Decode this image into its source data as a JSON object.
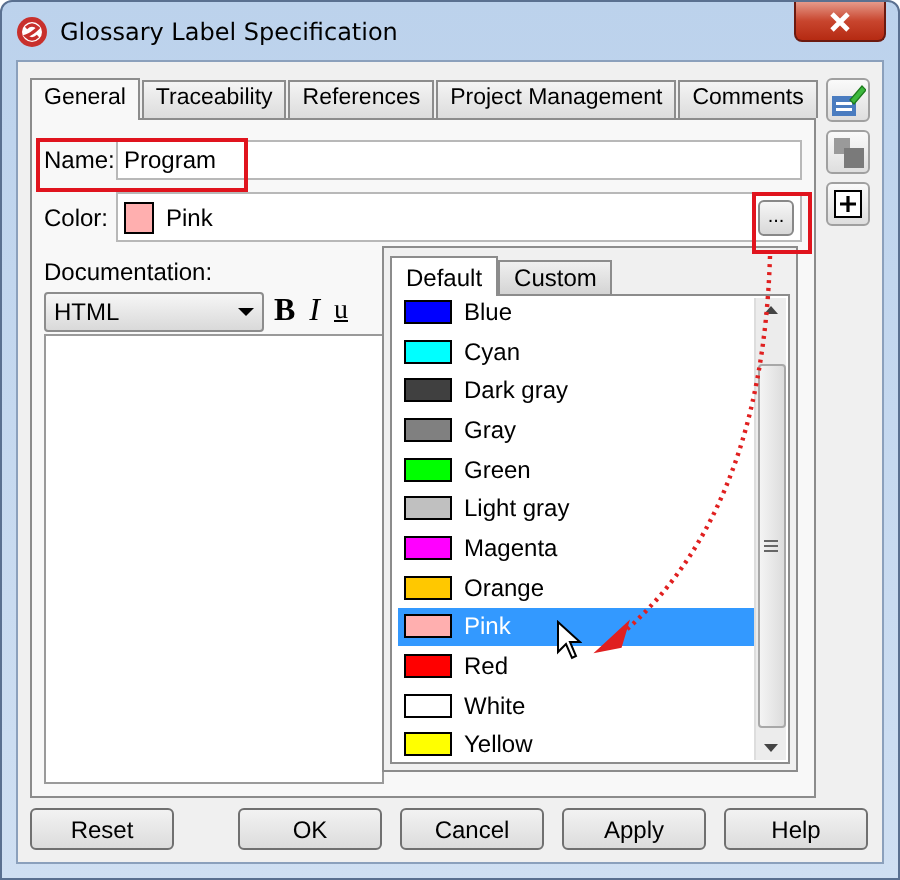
{
  "window": {
    "title": "Glossary Label Specification"
  },
  "tabs": [
    {
      "label": "General",
      "selected": true
    },
    {
      "label": "Traceability",
      "selected": false
    },
    {
      "label": "References",
      "selected": false
    },
    {
      "label": "Project Management",
      "selected": false
    },
    {
      "label": "Comments",
      "selected": false
    }
  ],
  "name_field": {
    "label": "Name:",
    "value": "Program"
  },
  "color_field": {
    "label": "Color:",
    "value": "Pink",
    "color": "#ffafaf",
    "button": "..."
  },
  "documentation": {
    "label": "Documentation:",
    "format": "HTML",
    "bold": "B",
    "italic": "I",
    "underline": "u"
  },
  "color_popup": {
    "tabs": [
      {
        "label": "Default",
        "selected": true
      },
      {
        "label": "Custom",
        "selected": false
      }
    ],
    "colors": [
      {
        "name": "Blue",
        "color": "#0000ff",
        "selected": false
      },
      {
        "name": "Cyan",
        "color": "#00ffff",
        "selected": false
      },
      {
        "name": "Dark gray",
        "color": "#404040",
        "selected": false
      },
      {
        "name": "Gray",
        "color": "#808080",
        "selected": false
      },
      {
        "name": "Green",
        "color": "#00ff00",
        "selected": false
      },
      {
        "name": "Light gray",
        "color": "#c0c0c0",
        "selected": false
      },
      {
        "name": "Magenta",
        "color": "#ff00ff",
        "selected": false
      },
      {
        "name": "Orange",
        "color": "#ffc800",
        "selected": false
      },
      {
        "name": "Pink",
        "color": "#ffafaf",
        "selected": true
      },
      {
        "name": "Red",
        "color": "#ff0000",
        "selected": false
      },
      {
        "name": "White",
        "color": "#ffffff",
        "selected": false
      },
      {
        "name": "Yellow",
        "color": "#ffff00",
        "selected": false
      }
    ]
  },
  "buttons": [
    {
      "label": "Reset"
    },
    {
      "label": "OK"
    },
    {
      "label": "Cancel"
    },
    {
      "label": "Apply"
    },
    {
      "label": "Help"
    }
  ]
}
